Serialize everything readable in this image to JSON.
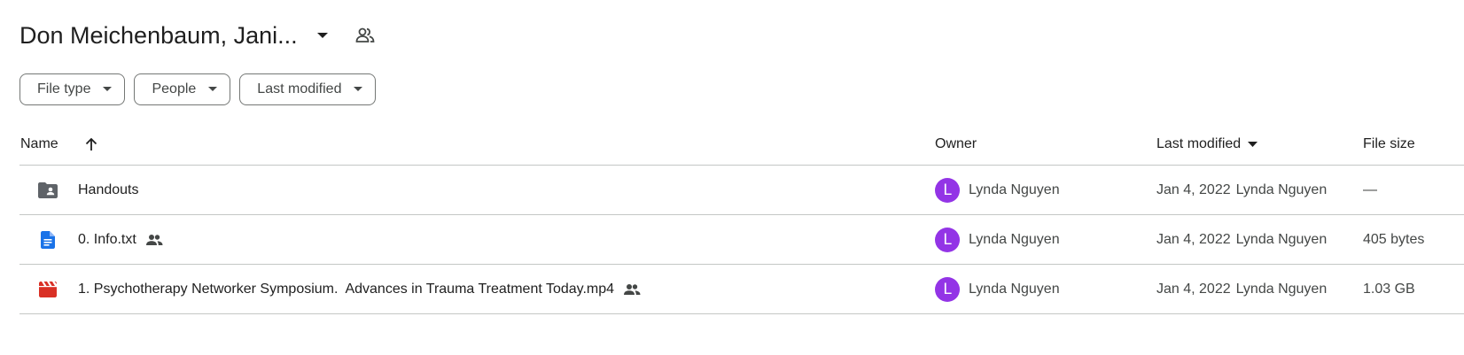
{
  "header": {
    "title": "Don Meichenbaum, Jani...",
    "title_caret_icon": "arrow-drop-down-icon",
    "people_icon": "shared-people-icon"
  },
  "filters": [
    {
      "label": "File type"
    },
    {
      "label": "People"
    },
    {
      "label": "Last modified"
    }
  ],
  "columns": {
    "name": "Name",
    "owner": "Owner",
    "last_modified": "Last modified",
    "file_size": "File size",
    "name_sort_icon": "arrow-upward-icon",
    "modified_sort_icon": "arrow-drop-down-icon"
  },
  "rows": [
    {
      "icon": "shared-folder-icon",
      "name": "Handouts",
      "shared": false,
      "owner_initial": "L",
      "owner": "Lynda Nguyen",
      "modified_date": "Jan 4, 2022",
      "modified_by": "Lynda Nguyen",
      "size": "—"
    },
    {
      "icon": "google-docs-icon",
      "name": "0. Info.txt",
      "shared": true,
      "owner_initial": "L",
      "owner": "Lynda Nguyen",
      "modified_date": "Jan 4, 2022",
      "modified_by": "Lynda Nguyen",
      "size": "405 bytes"
    },
    {
      "icon": "video-file-icon",
      "name": "1. Psychotherapy Networker Symposium.  Advances in Trauma Treatment Today.mp4",
      "shared": true,
      "owner_initial": "L",
      "owner": "Lynda Nguyen",
      "modified_date": "Jan 4, 2022",
      "modified_by": "Lynda Nguyen",
      "size": "1.03 GB"
    }
  ],
  "colors": {
    "avatar": "#9334e6",
    "docs_blue": "#1a73e8",
    "video_red": "#d93025",
    "folder_gray": "#5f6368"
  }
}
